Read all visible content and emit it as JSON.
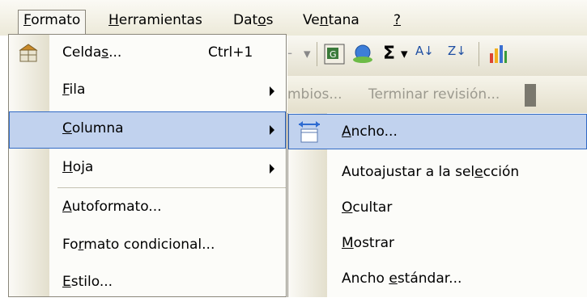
{
  "menubar": {
    "items": [
      {
        "label": "Formato",
        "mnemonic_index": 0
      },
      {
        "label": "Herramientas",
        "mnemonic_index": 0
      },
      {
        "label": "Datos",
        "mnemonic_index": 3
      },
      {
        "label": "Ventana",
        "mnemonic_index": 2
      },
      {
        "label": "?",
        "mnemonic_index": 0
      }
    ]
  },
  "toolbar": {
    "dash": "-",
    "sigma": "Σ",
    "sigma_dropdown": "▾",
    "sort_asc": "A↓",
    "sort_desc": "Z↓",
    "review_text_1": "mbios...",
    "review_text_2": "Terminar revisión..."
  },
  "format_menu": {
    "items": [
      {
        "label": "Celdas...",
        "mnemonic_index": 5,
        "shortcut": "Ctrl+1",
        "icon": "format-cells-icon"
      },
      {
        "label": "Fila",
        "mnemonic_index": 0,
        "submenu": true
      },
      {
        "label": "Columna",
        "mnemonic_index": 0,
        "submenu": true,
        "highlighted": true
      },
      {
        "label": "Hoja",
        "mnemonic_index": 0,
        "submenu": true
      },
      {
        "label": "Autoformato...",
        "mnemonic_index": 0
      },
      {
        "label": "Formato condicional...",
        "mnemonic_index": 2
      },
      {
        "label": "Estilo...",
        "mnemonic_index": 0
      }
    ]
  },
  "column_submenu": {
    "items": [
      {
        "label": "Ancho...",
        "mnemonic_index": 0,
        "highlighted": true,
        "icon": "column-width-icon"
      },
      {
        "label": "Autoajustar a la selección",
        "mnemonic_index": 20
      },
      {
        "label": "Ocultar",
        "mnemonic_index": 0
      },
      {
        "label": "Mostrar",
        "mnemonic_index": 0
      },
      {
        "label": "Ancho estándar...",
        "mnemonic_index": 6
      }
    ]
  },
  "colors": {
    "highlight_fill": "#c1d2ee",
    "highlight_border": "#316ac5",
    "menu_bg": "#fcfcf9"
  }
}
